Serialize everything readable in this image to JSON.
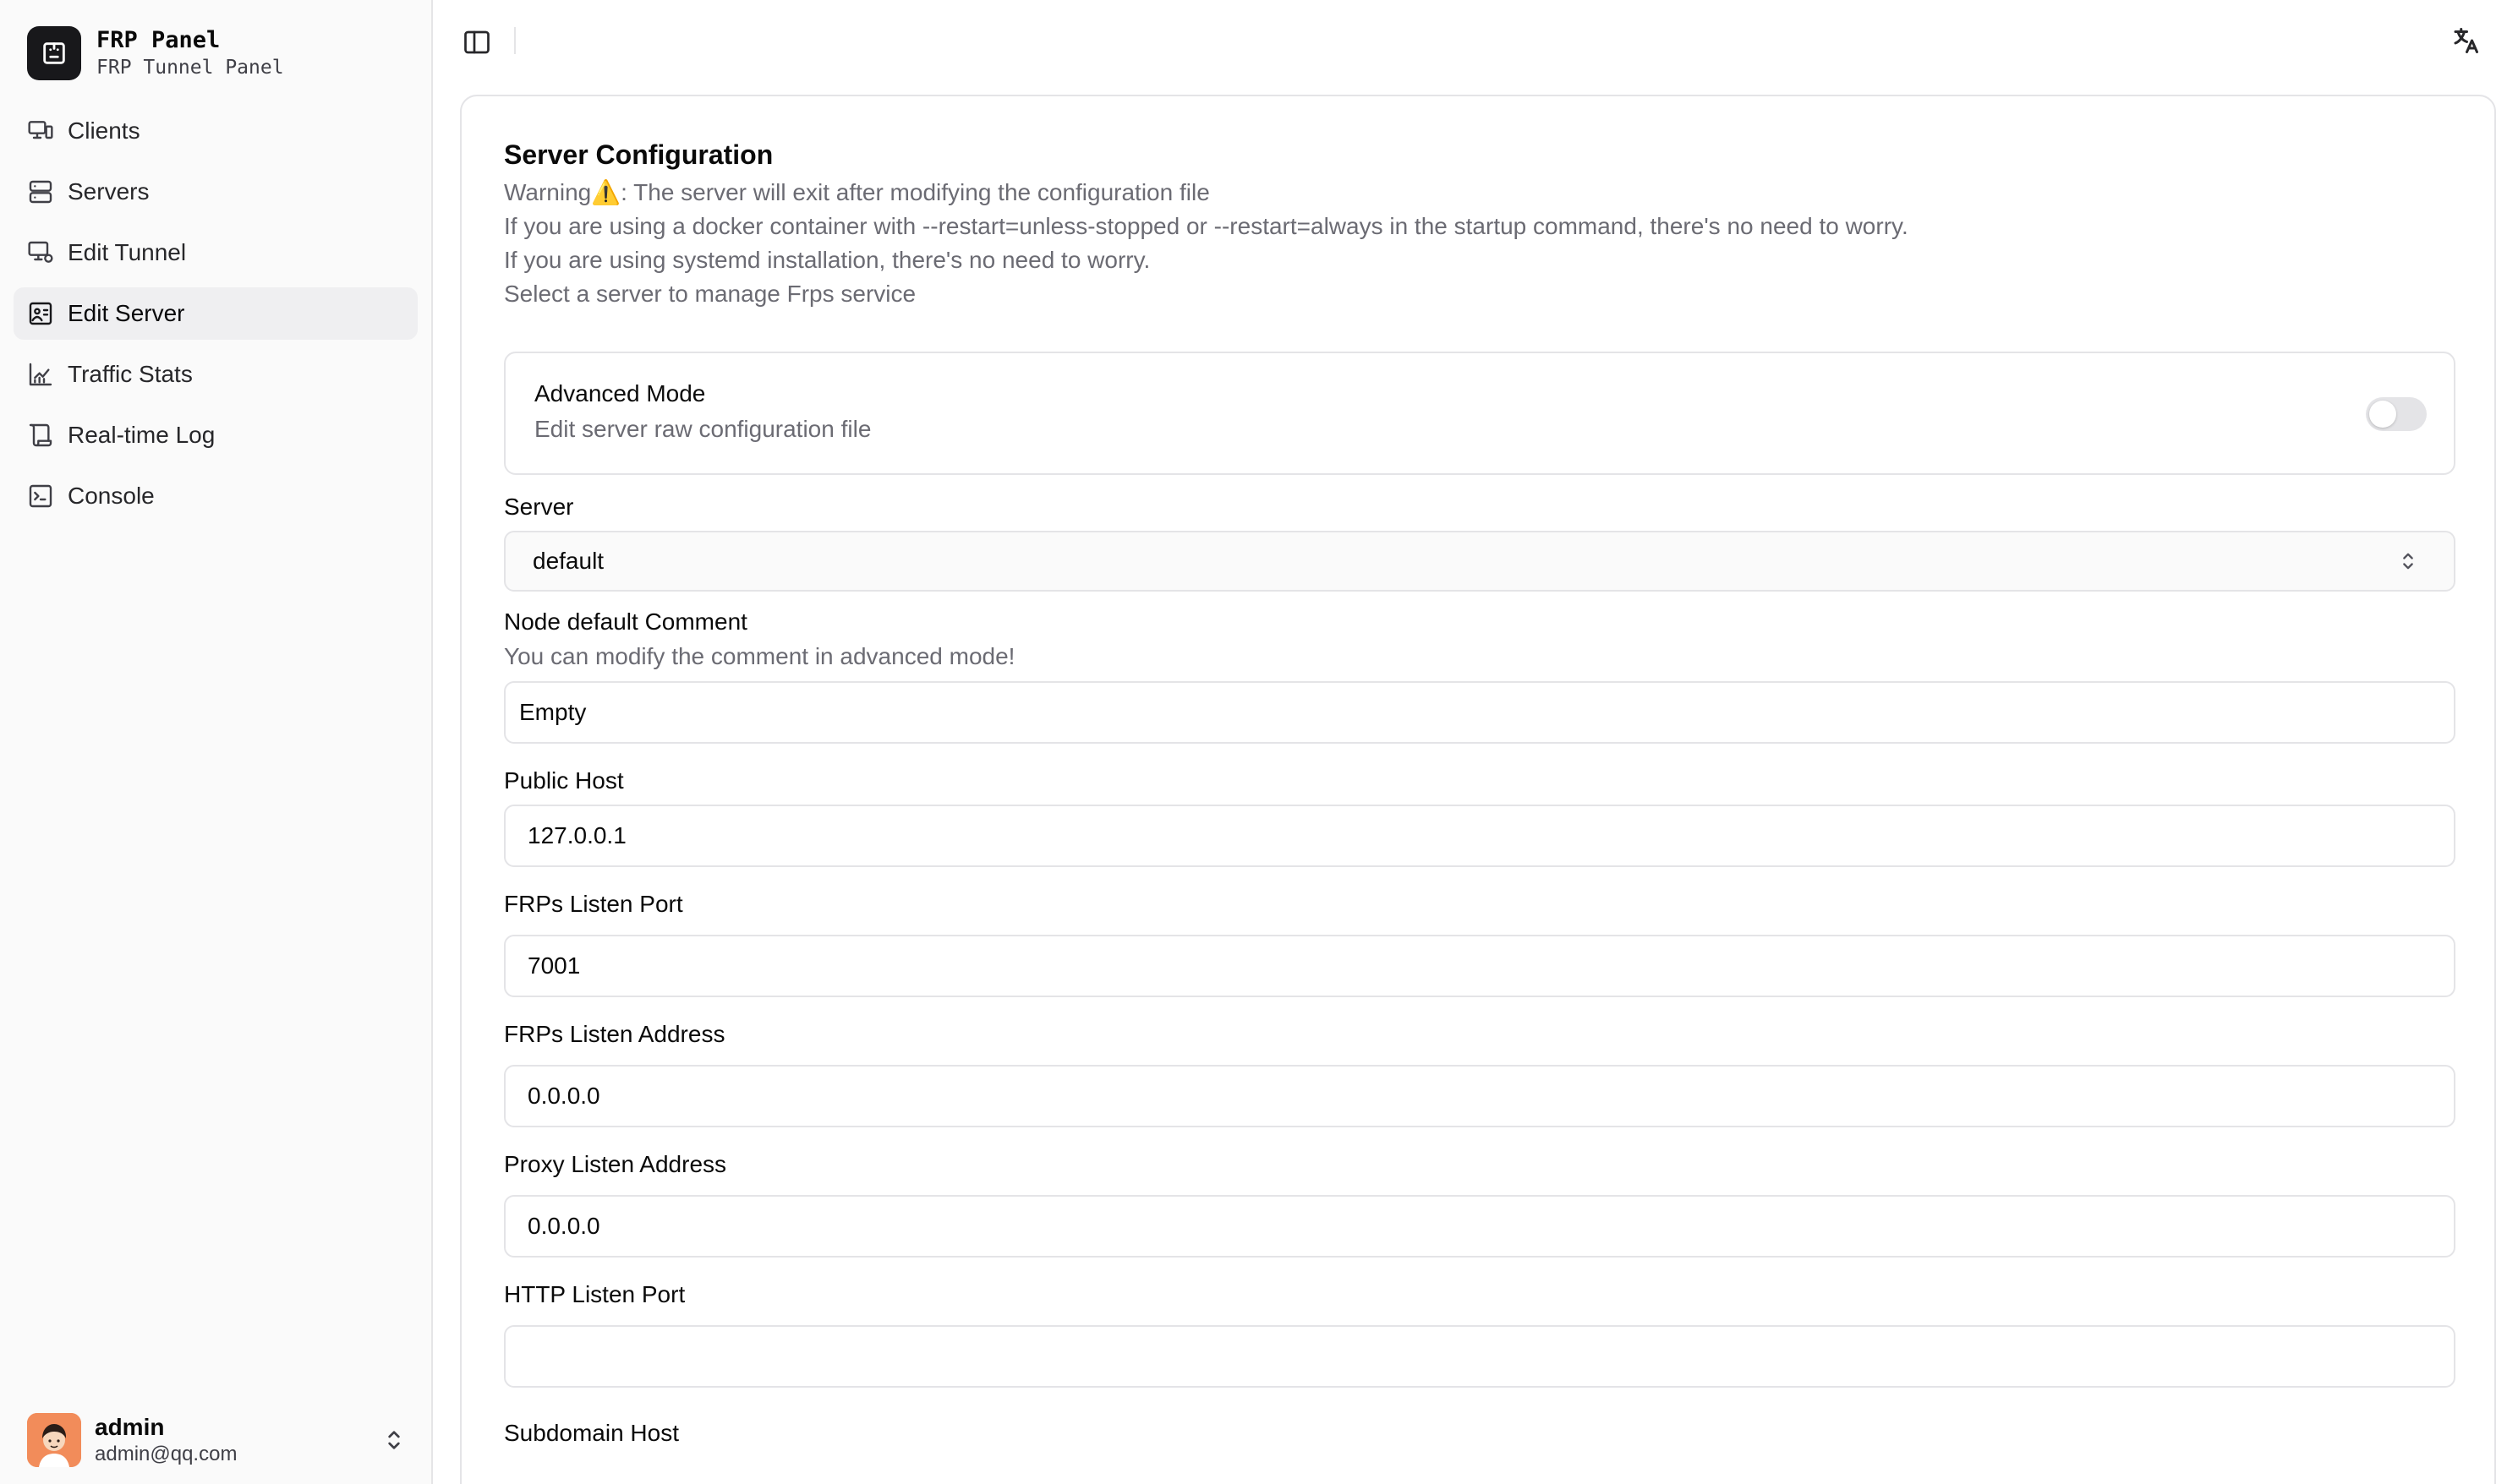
{
  "brand": {
    "title": "FRP Panel",
    "subtitle": "FRP Tunnel Panel"
  },
  "nav": [
    {
      "label": "Clients",
      "icon": "monitor-icon"
    },
    {
      "label": "Servers",
      "icon": "server-icon"
    },
    {
      "label": "Edit Tunnel",
      "icon": "edit-tunnel-icon"
    },
    {
      "label": "Edit Server",
      "icon": "edit-server-icon",
      "active": true
    },
    {
      "label": "Traffic Stats",
      "icon": "chart-icon"
    },
    {
      "label": "Real-time Log",
      "icon": "scroll-icon"
    },
    {
      "label": "Console",
      "icon": "terminal-icon"
    }
  ],
  "user": {
    "name": "admin",
    "email": "admin@qq.com"
  },
  "card": {
    "title": "Server Configuration",
    "desc": [
      "Warning⚠️: The server will exit after modifying the configuration file",
      "If you are using a docker container with --restart=unless-stopped or --restart=always in the startup command, there's no need to worry.",
      "If you are using systemd installation, there's no need to worry.",
      "Select a server to manage Frps service"
    ]
  },
  "advanced": {
    "title": "Advanced Mode",
    "desc": "Edit server raw configuration file",
    "enabled": false
  },
  "form": {
    "server_label": "Server",
    "server_value": "default",
    "comment_label": "Node default Comment",
    "comment_help": "You can modify the comment in advanced mode!",
    "comment_value": "Empty",
    "public_host_label": "Public Host",
    "public_host_value": "127.0.0.1",
    "listen_port_label": "FRPs Listen Port",
    "listen_port_value": "7001",
    "listen_addr_label": "FRPs Listen Address",
    "listen_addr_value": "0.0.0.0",
    "proxy_addr_label": "Proxy Listen Address",
    "proxy_addr_value": "0.0.0.0",
    "http_port_label": "HTTP Listen Port",
    "http_port_value": "",
    "subdomain_label": "Subdomain Host"
  },
  "colors": {
    "accent": "#18181b",
    "muted_text": "#6b6b73",
    "border": "#e4e4e7",
    "sidebar_bg": "#fafafa"
  }
}
